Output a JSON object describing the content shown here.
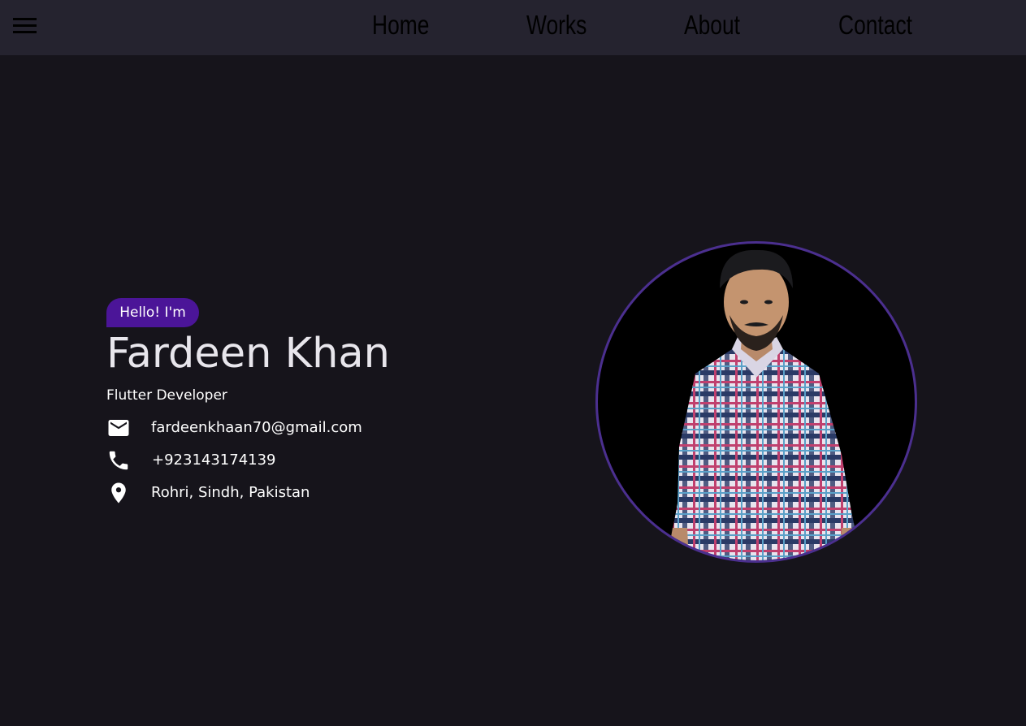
{
  "nav": {
    "menu_icon": "hamburger-menu-icon",
    "links": [
      "Home",
      "Works",
      "About",
      "Contact"
    ]
  },
  "hero": {
    "greeting": "Hello! I'm",
    "name": "Fardeen Khan",
    "title": "Flutter Developer",
    "email": "fardeenkhaan70@gmail.com",
    "phone": "+923143174139",
    "location": "Rohri, Sindh, Pakistan",
    "icons": {
      "email": "mail-icon",
      "phone": "phone-icon",
      "location": "location-pin-icon"
    }
  },
  "profile_photo": {
    "subject": "avatar"
  },
  "colors": {
    "background": "#16141b",
    "navbar": "#25232f",
    "accent": "#4b1598",
    "avatar_border": "#4b2f8f",
    "text": "#ffffff"
  }
}
